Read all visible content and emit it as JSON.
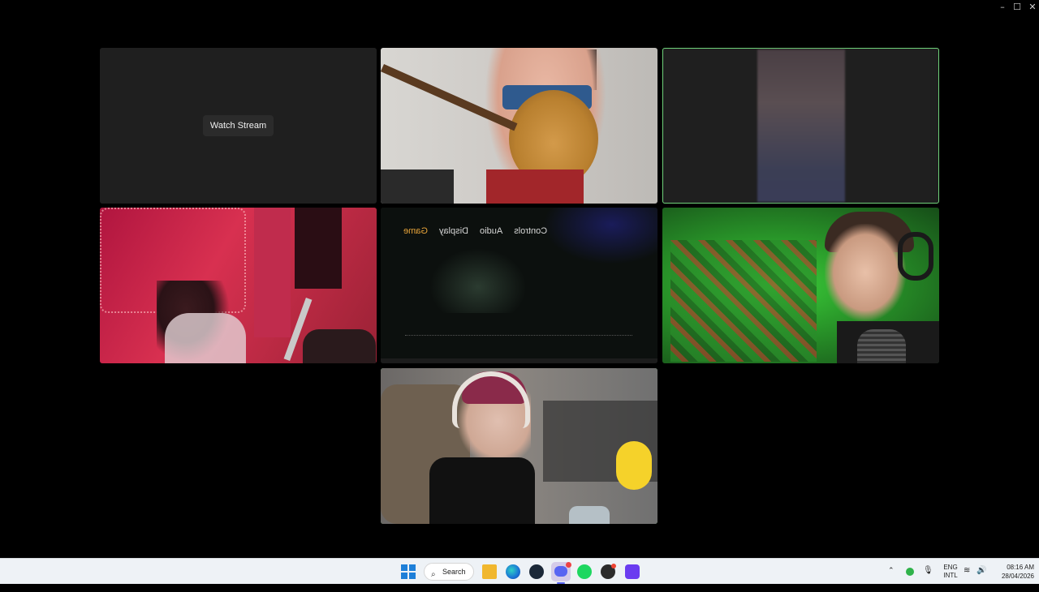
{
  "window": {
    "controls": {
      "minimize": "–",
      "maximize": "☐",
      "close": "✕"
    }
  },
  "tiles": [
    {
      "id": "tile-1",
      "button_label": "Watch Stream"
    },
    {
      "id": "tile-5",
      "game_menu": [
        "Game",
        "Display",
        "Audio",
        "Controls"
      ]
    }
  ],
  "taskbar": {
    "search_label": "Search",
    "tray": {
      "lang_top": "ENG",
      "lang_bottom": "INTL",
      "time": "08:16 AM",
      "date": "28/04/2026"
    }
  },
  "colors": {
    "active_speaker_outline": "#6fd27a"
  }
}
